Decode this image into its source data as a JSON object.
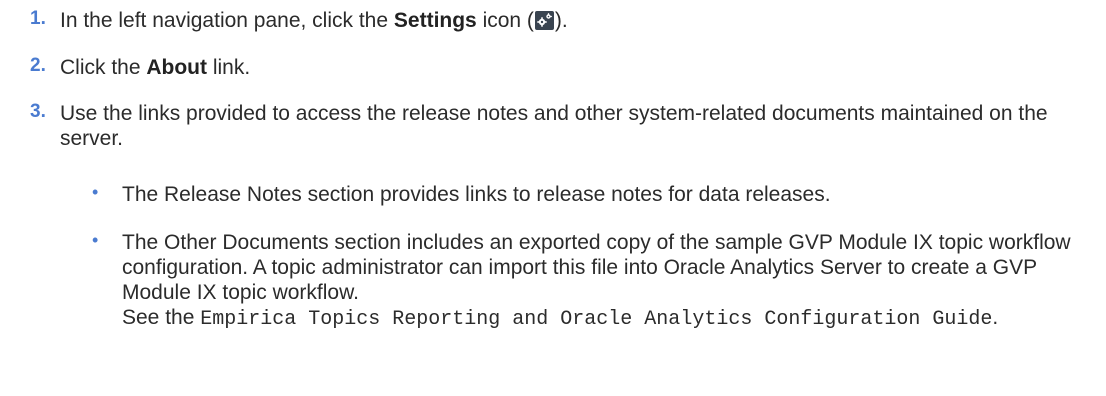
{
  "steps": [
    {
      "number": "1.",
      "text_before": "In the left navigation pane, click the ",
      "bold": "Settings",
      "text_middle": " icon (",
      "icon": "settings-gear-icon",
      "text_after": ")."
    },
    {
      "number": "2.",
      "text_before": "Click the ",
      "bold": "About",
      "text_after": " link."
    },
    {
      "number": "3.",
      "text": "Use the links provided to access the release notes and other system-related documents maintained on the server."
    }
  ],
  "bullets": [
    {
      "symbol": "•",
      "text": "The Release Notes section provides links to release notes for data releases."
    },
    {
      "symbol": "•",
      "text": "The Other Documents section includes an exported copy of the sample GVP Module IX topic workflow configuration. A topic administrator can import this file into Oracle Analytics Server to create a GVP Module IX topic workflow.",
      "see_prefix": "See the ",
      "guide_title": "Empirica Topics Reporting and Oracle Analytics Configuration Guide",
      "see_suffix": "."
    }
  ],
  "colors": {
    "accent": "#4a7bd0",
    "text": "#2b2b2b",
    "icon_bg": "#3a4450"
  }
}
